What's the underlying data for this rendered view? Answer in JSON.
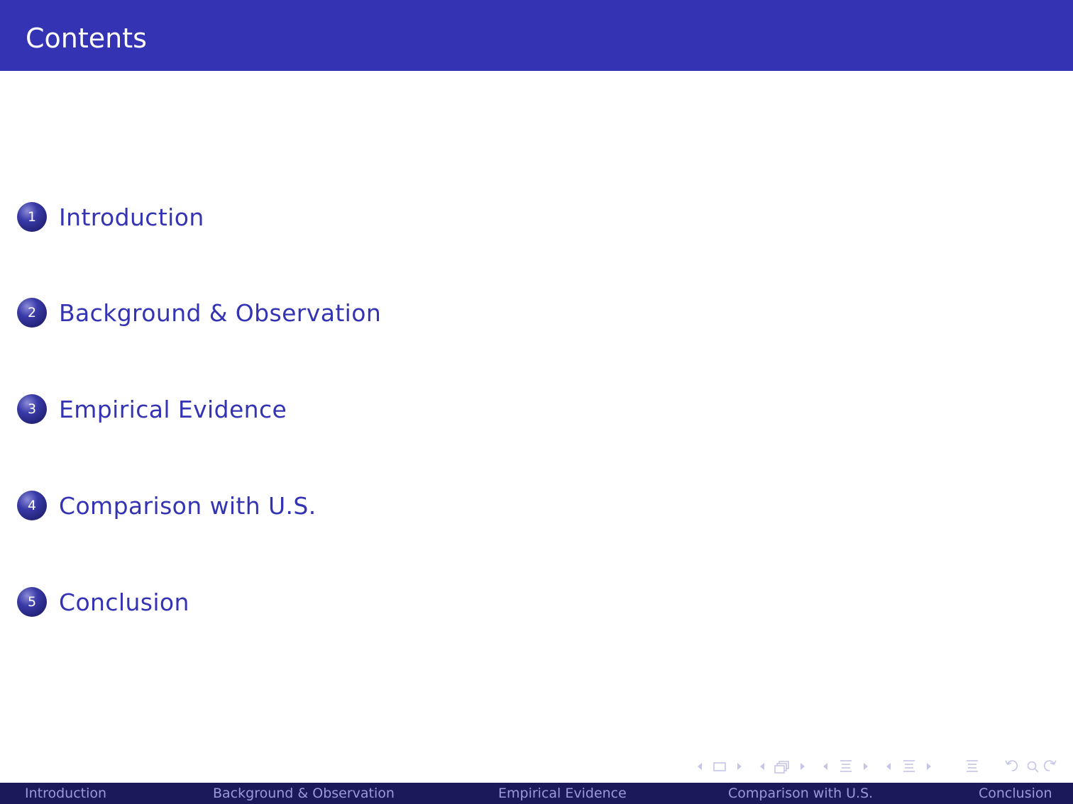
{
  "frame": {
    "title": "Contents"
  },
  "toc": {
    "items": [
      {
        "number": "1",
        "label": "Introduction"
      },
      {
        "number": "2",
        "label": "Background & Observation"
      },
      {
        "number": "3",
        "label": "Empirical Evidence"
      },
      {
        "number": "4",
        "label": "Comparison with U.S."
      },
      {
        "number": "5",
        "label": "Conclusion"
      }
    ]
  },
  "navigation": {
    "sections": [
      "Introduction",
      "Background & Observation",
      "Empirical Evidence",
      "Comparison with U.S.",
      "Conclusion"
    ],
    "symbols": [
      "frame-back-arrow-icon",
      "frame-icon",
      "frame-forward-arrow-icon",
      "subsection-back-arrow-icon",
      "subsection-icon",
      "subsection-forward-arrow-icon",
      "section-back-arrow-icon",
      "section-icon",
      "section-forward-arrow-icon",
      "document-back-arrow-icon",
      "document-icon",
      "document-forward-arrow-icon",
      "appendix-icon",
      "back-undo-icon",
      "search-icon",
      "forward-redo-icon"
    ]
  },
  "colors": {
    "structure": "#3333b3",
    "footline_background": "#1a1a59",
    "footline_text": "#9a9ad6",
    "nav_symbols": "#c5c5e8"
  }
}
